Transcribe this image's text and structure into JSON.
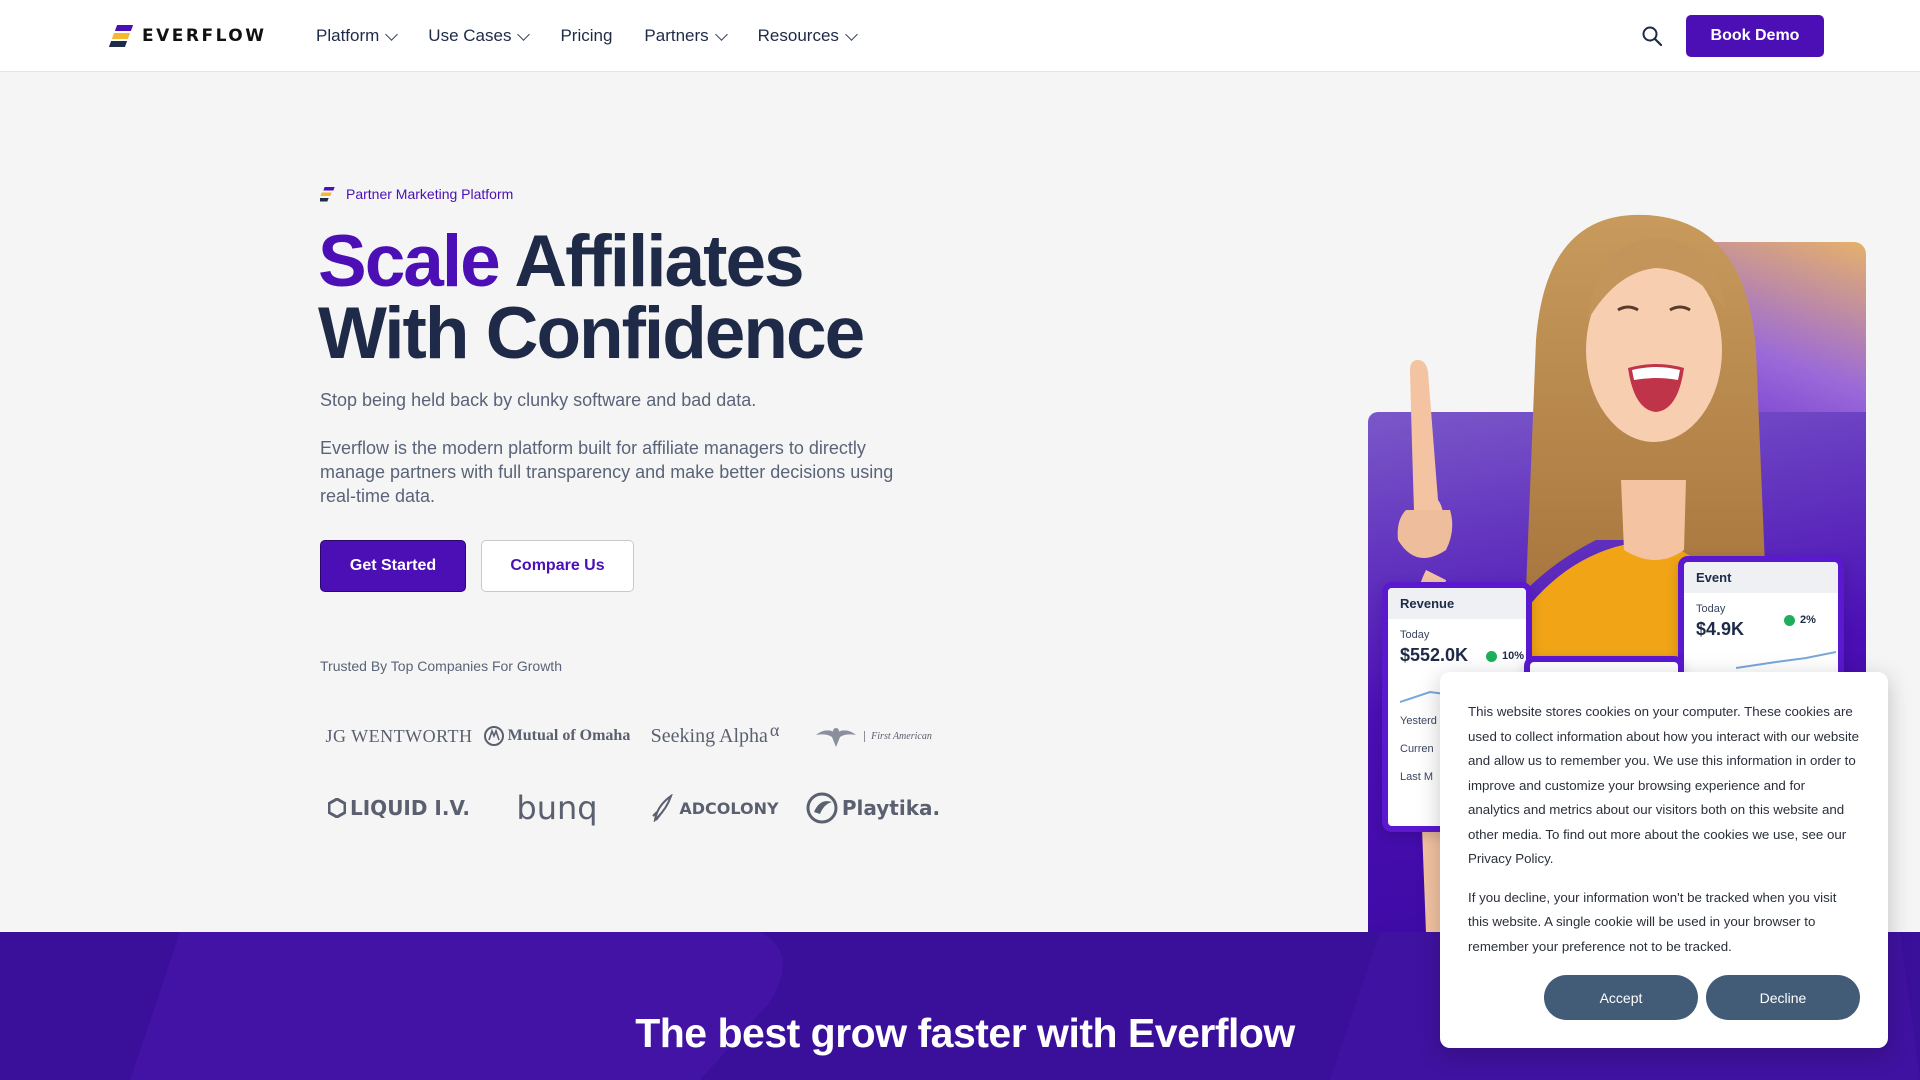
{
  "nav": {
    "brand": "EVERFLOW",
    "items": [
      {
        "label": "Platform",
        "dropdown": true
      },
      {
        "label": "Use Cases",
        "dropdown": true
      },
      {
        "label": "Pricing",
        "dropdown": false
      },
      {
        "label": "Partners",
        "dropdown": true
      },
      {
        "label": "Resources",
        "dropdown": true
      }
    ],
    "cta": "Book Demo",
    "search_icon": "search-icon"
  },
  "hero": {
    "eyebrow": "Partner Marketing Platform",
    "headline_accent": "Scale",
    "headline_rest_line1": "Affiliates",
    "headline_line2": "With Confidence",
    "subheadline": "Stop being held back by clunky software and bad data.",
    "description": "Everflow is the modern platform built for affiliate managers to directly manage partners with full transparency and make better decisions using real-time data.",
    "primary_button": "Get Started",
    "secondary_button": "Compare Us",
    "trusted_label": "Trusted By Top Companies For Growth",
    "logos": {
      "jg_wentworth": "JG WENTWORTH",
      "mutual_omaha": "Mutual of Omaha",
      "seeking_alpha": "Seeking Alpha",
      "seeking_alpha_symbol": "α",
      "first_american": "First American",
      "liquid_iv": "LIQUID I.V.",
      "bunq": "bunq",
      "adcolony": "ADCOLONY",
      "playtika": "Playtika."
    }
  },
  "cards": {
    "revenue": {
      "title": "Revenue",
      "label": "Today",
      "value": "$552.0K",
      "change": "10%",
      "rows": [
        "Yesterd",
        "Curren",
        "Last M"
      ]
    },
    "event": {
      "title": "Event",
      "label": "Today",
      "value": "$4.9K",
      "change": "2%"
    }
  },
  "cookie": {
    "paragraph1": "This website stores cookies on your computer. These cookies are used to collect information about how you interact with our website and allow us to remember you. We use this information in order to improve and customize your browsing experience and for analytics and metrics about our visitors both on this website and other media. To find out more about the cookies we use, see our Privacy Policy.",
    "paragraph2": "If you decline, your information won't be tracked when you visit this website. A single cookie will be used in your browser to remember your preference not to be tracked.",
    "accept": "Accept",
    "decline": "Decline"
  },
  "band": {
    "title": "The best grow faster with Everflow"
  },
  "colors": {
    "brand_purple": "#4b0fb5",
    "navy_text": "#1e2a47",
    "cookie_button": "#425b76",
    "band": "#3a0f9a",
    "logo_yellow": "#f5b82e"
  }
}
